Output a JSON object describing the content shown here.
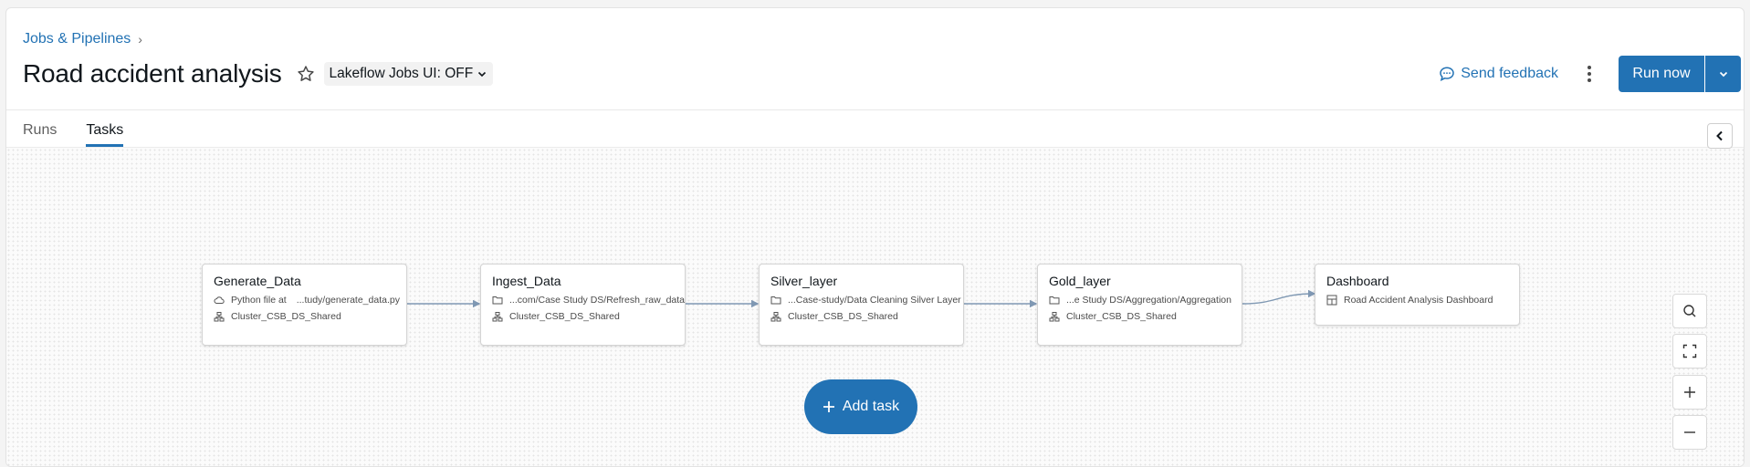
{
  "breadcrumb": {
    "label": "Jobs & Pipelines",
    "separator": "›"
  },
  "page": {
    "title": "Road accident analysis"
  },
  "ui_toggle": {
    "label": "Lakeflow Jobs UI: OFF"
  },
  "header": {
    "feedback_label": "Send feedback",
    "run_now_label": "Run now"
  },
  "tabs": [
    {
      "label": "Runs",
      "active": false
    },
    {
      "label": "Tasks",
      "active": true
    }
  ],
  "tasks": [
    {
      "name": "Generate_Data",
      "source_prefix": "Python file at",
      "source": "...tudy/generate_data.py",
      "source_icon": "cloud-icon",
      "cluster": "Cluster_CSB_DS_Shared"
    },
    {
      "name": "Ingest_Data",
      "source": "...com/Case Study DS/Refresh_raw_data",
      "source_icon": "folder-icon",
      "cluster": "Cluster_CSB_DS_Shared"
    },
    {
      "name": "Silver_layer",
      "source": "...Case-study/Data Cleaning Silver Layer",
      "source_icon": "folder-icon",
      "cluster": "Cluster_CSB_DS_Shared"
    },
    {
      "name": "Gold_layer",
      "source": "...e Study DS/Aggregation/Aggregation",
      "source_icon": "folder-icon",
      "cluster": "Cluster_CSB_DS_Shared"
    },
    {
      "name": "Dashboard",
      "source": "Road Accident Analysis Dashboard",
      "source_icon": "dashboard-icon"
    }
  ],
  "add_task_label": "Add task",
  "colors": {
    "accent": "#2272b4",
    "edge": "#7f98b3"
  }
}
